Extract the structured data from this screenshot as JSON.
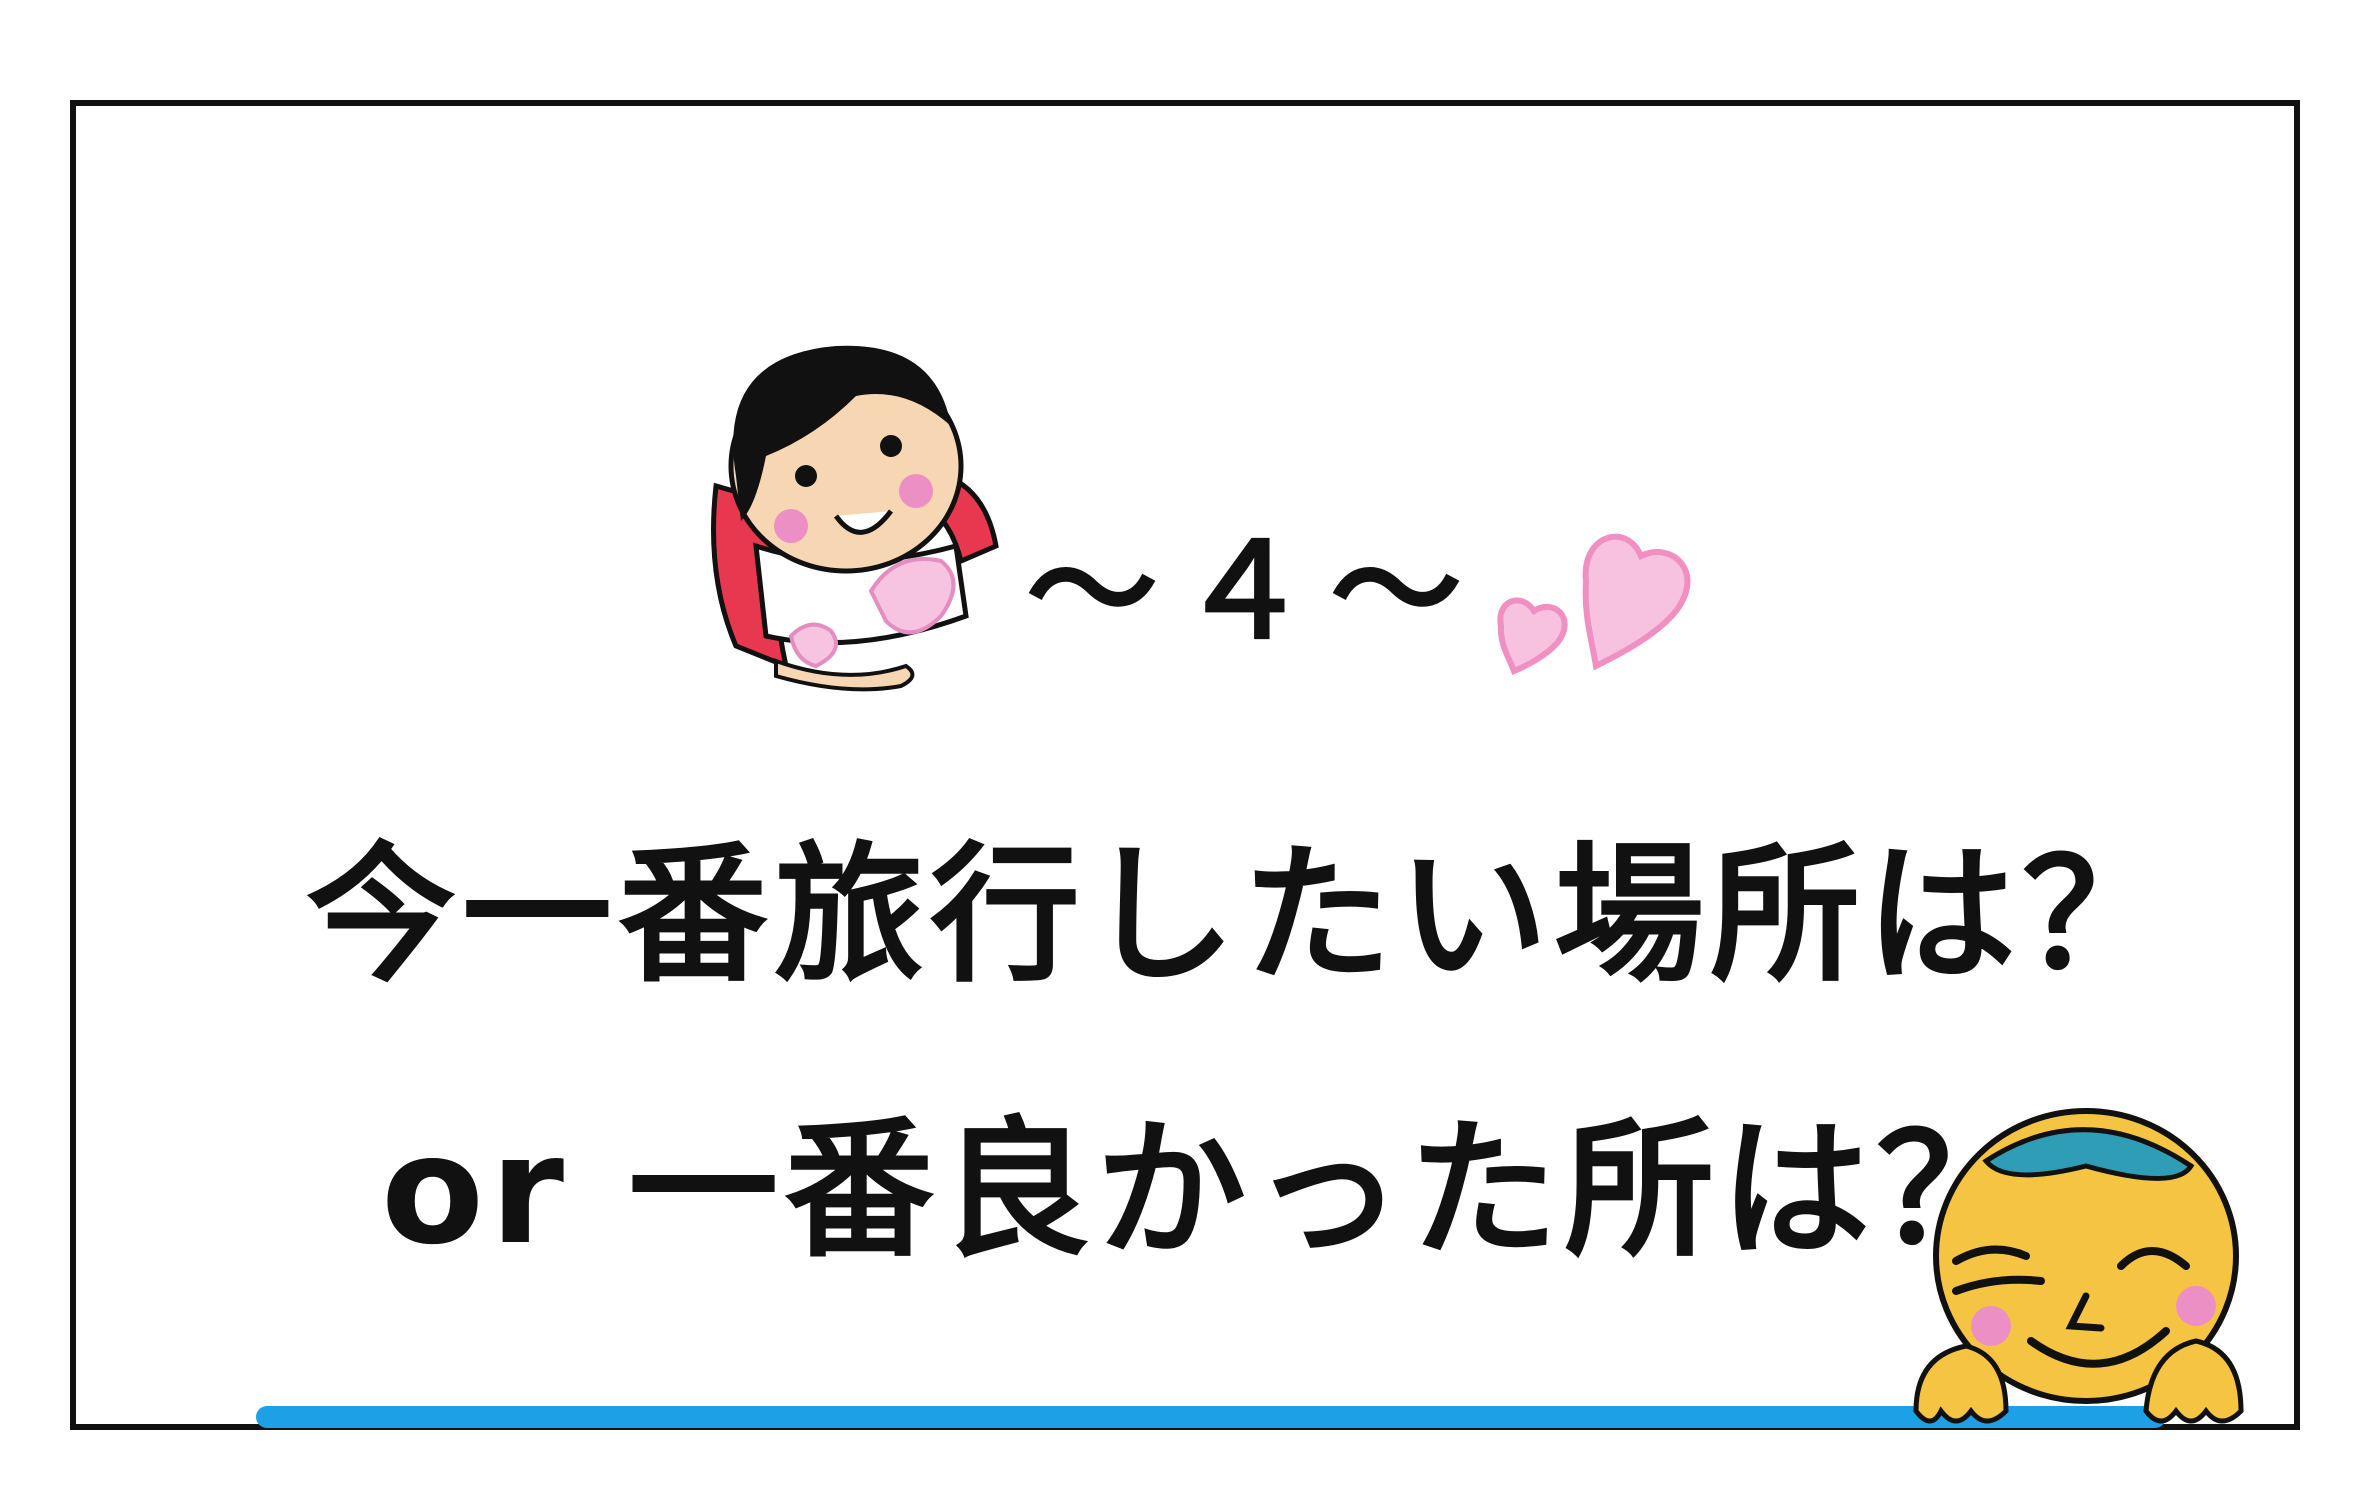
{
  "card": {
    "heading": "～４～",
    "line1": "今一番旅行したい場所は？",
    "line2": "or 一番良かった所は？"
  },
  "illustrations": {
    "girl_icon": "girl-with-heart-icon",
    "hearts_icon": "pink-hearts-icon",
    "face_icon": "smiling-face-icon"
  },
  "colors": {
    "underline": "#1ea0e6",
    "frame": "#111111",
    "girl_sleeve": "#e8384f",
    "heart_pink": "#f4a7cf",
    "face_yellow": "#f5c443",
    "cap_teal": "#2f9db5"
  }
}
